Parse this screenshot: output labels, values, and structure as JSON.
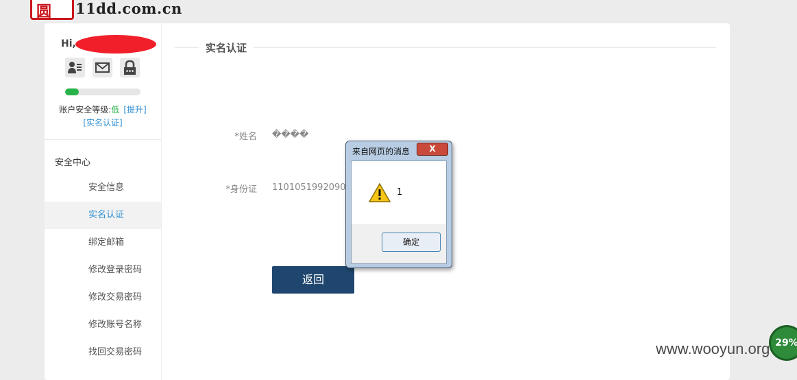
{
  "logo": {
    "mark": "圆",
    "domain": "11dd.com.cn"
  },
  "sidebar": {
    "greeting": "Hi,",
    "security_progress": 0.18,
    "security_label": "账户安全等级:",
    "security_level": "低",
    "upgrade_link": "[提升]",
    "realname_link": "[实名认证]",
    "menu_heading": "安全中心",
    "items": [
      {
        "label": "安全信息"
      },
      {
        "label": "实名认证"
      },
      {
        "label": "绑定邮箱"
      },
      {
        "label": "修改登录密码"
      },
      {
        "label": "修改交易密码"
      },
      {
        "label": "修改账号名称"
      },
      {
        "label": "找回交易密码"
      }
    ]
  },
  "content": {
    "title": "实名认证",
    "name_label": "*姓名",
    "name_value": "����",
    "id_label": "*身份证",
    "id_value": "11010519920901",
    "back_button": "返回"
  },
  "dialog": {
    "title": "来自网页的消息",
    "close": "X",
    "message": "1",
    "ok_button": "确定"
  },
  "overlay": {
    "watermark": "www.wooyun.org",
    "speed_badge": "29%"
  },
  "colors": {
    "accent": "#2d8fd1",
    "button": "#1f466e",
    "progress": "#27b34a",
    "redaction": "#f01f2a"
  }
}
